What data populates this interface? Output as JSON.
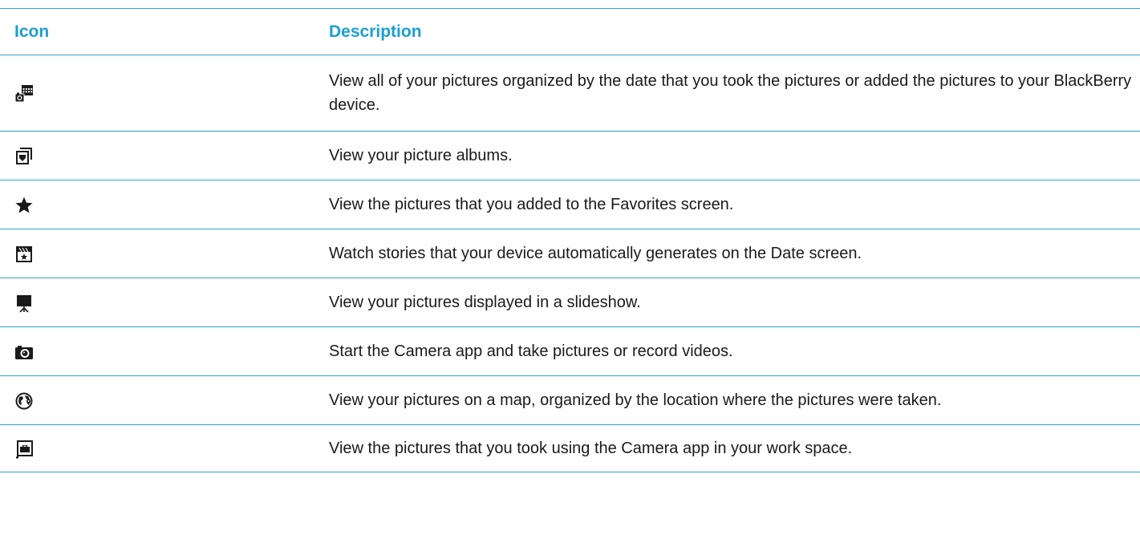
{
  "table": {
    "headers": {
      "icon": "Icon",
      "description": "Description"
    },
    "rows": [
      {
        "icon": "camera-calendar-icon",
        "description": "View all of your pictures organized by the date that you took the pictures or added the pictures to your BlackBerry device."
      },
      {
        "icon": "picture-albums-icon",
        "description": "View your picture albums."
      },
      {
        "icon": "star-icon",
        "description": "View the pictures that you added to the Favorites screen."
      },
      {
        "icon": "story-clapper-icon",
        "description": "Watch stories that your device automatically generates on the Date screen."
      },
      {
        "icon": "slideshow-easel-icon",
        "description": "View your pictures displayed in a slideshow."
      },
      {
        "icon": "camera-icon",
        "description": "Start the Camera app and take pictures or record videos."
      },
      {
        "icon": "globe-map-icon",
        "description": "View your pictures on a map, organized by the location where the pictures were taken."
      },
      {
        "icon": "work-briefcase-icon",
        "description": "View the pictures that you took using the Camera app in your work space."
      }
    ]
  },
  "colors": {
    "accent": "#1a9fd6",
    "rule": "#2ba3d0",
    "text": "#1a1a1a"
  }
}
